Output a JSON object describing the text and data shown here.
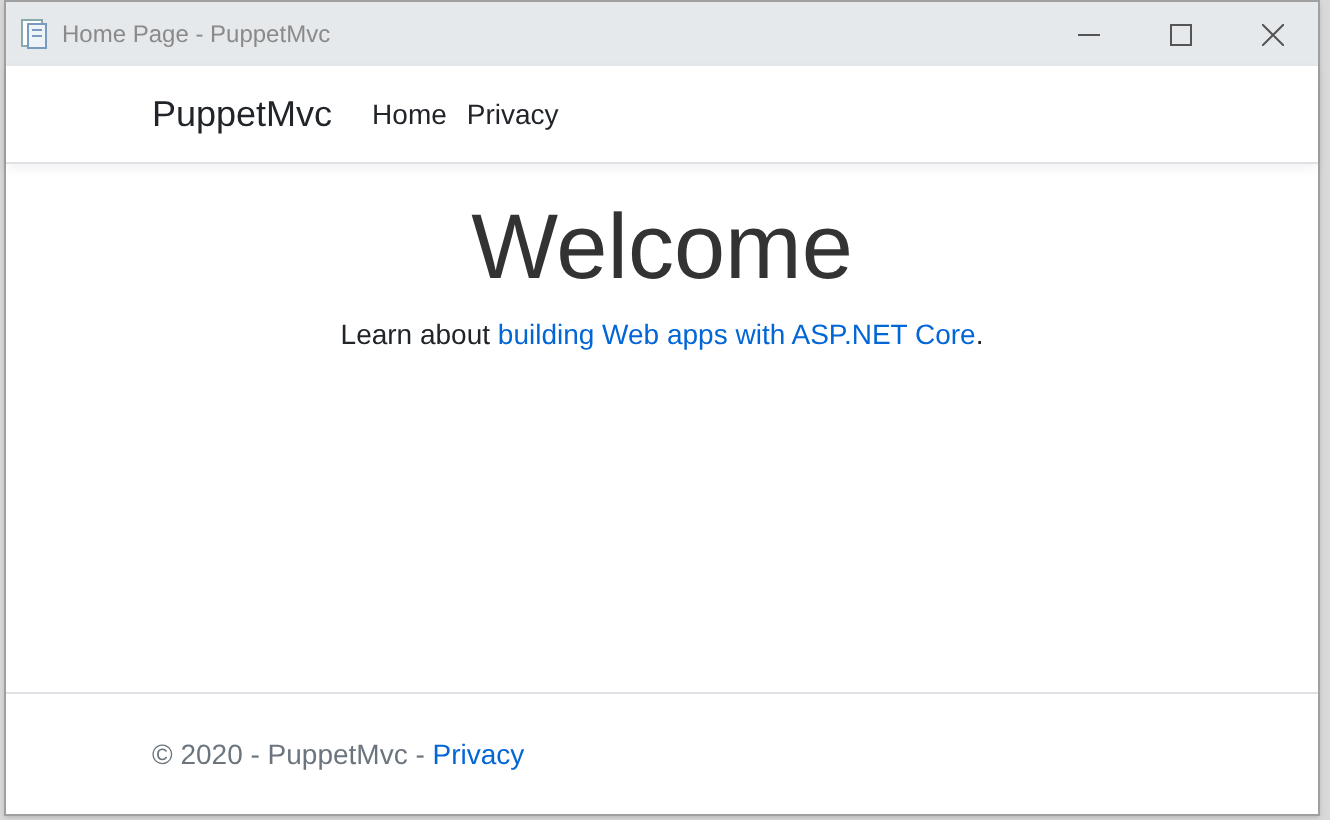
{
  "window": {
    "title": "Home Page - PuppetMvc"
  },
  "navbar": {
    "brand": "PuppetMvc",
    "links": [
      "Home",
      "Privacy"
    ]
  },
  "main": {
    "heading": "Welcome",
    "text_before": "Learn about ",
    "link": "building Web apps with ASP.NET Core",
    "text_after": "."
  },
  "footer": {
    "text": "© 2020 - PuppetMvc - ",
    "link": "Privacy"
  }
}
